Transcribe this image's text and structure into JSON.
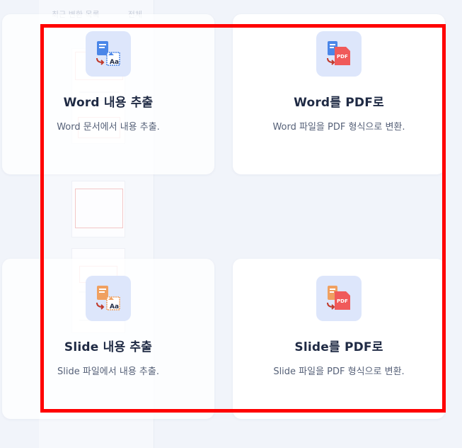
{
  "background_panel": {
    "heading": "최근 변환 목록",
    "heading_right": "전체"
  },
  "cards": [
    {
      "title": "Word 내용 추출",
      "description": "Word 문서에서 내용 추출."
    },
    {
      "title": "Word를 PDF로",
      "description": "Word 파일을 PDF 형식으로 변환."
    },
    {
      "title": "Slide 내용 추출",
      "description": "Slide 파일에서 내용 추출."
    },
    {
      "title": "Slide를 PDF로",
      "description": "Slide 파일을 PDF 형식으로 변환."
    }
  ],
  "icons": {
    "pdf_badge": "PDF",
    "aa_badge": "Aa"
  },
  "colors": {
    "highlight": "#ff0000",
    "word_blue": "#4a86e8",
    "pdf_red": "#f05a5a",
    "slide_orange": "#f0a060",
    "arrow_red": "#c0392b"
  }
}
